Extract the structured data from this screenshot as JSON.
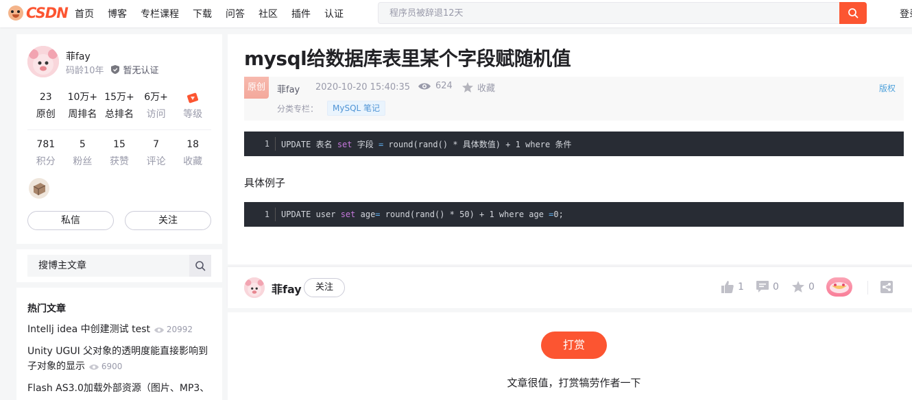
{
  "nav": {
    "logo": "CSDN",
    "items": [
      "首页",
      "博客",
      "专栏课程",
      "下载",
      "问答",
      "社区",
      "插件",
      "认证"
    ],
    "search_placeholder": "程序员被辞退12天",
    "login": "登录"
  },
  "profile": {
    "name": "菲fay",
    "years": "码龄10年",
    "cert": "暂无认证",
    "stats_row1": [
      {
        "num": "23",
        "label": "原创"
      },
      {
        "num": "10万+",
        "label": "周排名"
      },
      {
        "num": "15万+",
        "label": "总排名"
      },
      {
        "num": "6万+",
        "label": "访问"
      },
      {
        "num": "",
        "label": "等级"
      }
    ],
    "stats_row2": [
      {
        "num": "781",
        "label": "积分"
      },
      {
        "num": "5",
        "label": "粉丝"
      },
      {
        "num": "15",
        "label": "获赞"
      },
      {
        "num": "7",
        "label": "评论"
      },
      {
        "num": "18",
        "label": "收藏"
      }
    ],
    "message_button": "私信",
    "follow_button": "关注"
  },
  "sidebar_search": {
    "placeholder": "搜博主文章"
  },
  "hot": {
    "title": "热门文章",
    "items": [
      {
        "title": "Intellj idea 中创建测试 test",
        "views": "20992"
      },
      {
        "title": "Unity UGUI 父对象的透明度能直接影响到子对象的显示",
        "views": "6900"
      },
      {
        "title": "Flash AS3.0加载外部资源（图片、MP3、",
        "views": ""
      }
    ]
  },
  "article": {
    "title": "mysql给数据库表里某个字段赋随机值",
    "tag": "原创",
    "author": "菲fay",
    "date": "2020-10-20 15:40:35",
    "views": "624",
    "favorite": "收藏",
    "copyright": "版权",
    "column_label": "分类专栏：",
    "column_tag": "MySQL 笔记",
    "code1": {
      "line": "1"
    },
    "example_label": "具体例子",
    "code2": {
      "line": "1"
    }
  },
  "toolbar": {
    "author": "菲fay",
    "follow": "关注",
    "likes": "1",
    "comments": "0",
    "favorites": "0"
  },
  "reward": {
    "button": "打赏",
    "text": "文章很值，打赏犒劳作者一下"
  },
  "colors": {
    "accent": "#fc5531",
    "link": "#5094d5",
    "code_bg": "#282c34"
  }
}
